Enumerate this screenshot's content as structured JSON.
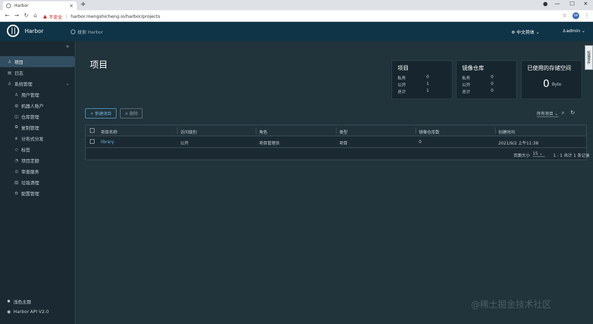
{
  "browser": {
    "tab_title": "Harbor",
    "new_tab": "+",
    "insecure_label": "不安全",
    "url": "harbor.mengshicheng.io/harbor/projects",
    "profile_initials": "SM"
  },
  "header": {
    "brand": "Harbor",
    "search_placeholder": "搜索 Harbor",
    "language": "中文简体",
    "user": "admin"
  },
  "sidebar": {
    "items": [
      {
        "label": "项目",
        "icon": "projects-icon"
      },
      {
        "label": "日志",
        "icon": "logs-icon"
      },
      {
        "label": "系统管理",
        "icon": "admin-icon"
      }
    ],
    "sub_items": [
      {
        "label": "用户管理",
        "icon": "users-icon"
      },
      {
        "label": "机器人账户",
        "icon": "robot-icon"
      },
      {
        "label": "仓库管理",
        "icon": "registry-icon"
      },
      {
        "label": "复制管理",
        "icon": "replication-icon"
      },
      {
        "label": "分布式分发",
        "icon": "distribution-icon"
      },
      {
        "label": "标签",
        "icon": "tag-icon"
      },
      {
        "label": "项目定额",
        "icon": "quota-icon"
      },
      {
        "label": "审查服务",
        "icon": "scanner-icon"
      },
      {
        "label": "垃圾清理",
        "icon": "gc-icon"
      },
      {
        "label": "配置管理",
        "icon": "config-icon"
      }
    ],
    "theme_label": "浅色主题",
    "api_label": "Harbor API V2.0"
  },
  "main": {
    "title": "项目",
    "cards": {
      "projects": {
        "title": "项目",
        "private_label": "私有",
        "private": "0",
        "public_label": "公开",
        "public": "1",
        "total_label": "总计",
        "total": "1"
      },
      "repos": {
        "title": "镜像仓库",
        "private_label": "私有",
        "private": "0",
        "public_label": "公开",
        "public": "0",
        "total_label": "总计",
        "total": "0"
      },
      "storage": {
        "title": "已使用的存储空间",
        "value": "0",
        "unit": "Byte"
      }
    },
    "new_project_label": "+ 新建项目",
    "delete_label": "✕ 删除",
    "filter_label": "所有项目",
    "table": {
      "headers": [
        "项目名称",
        "访问级别",
        "角色",
        "类型",
        "镜像仓库数",
        "创建时间"
      ],
      "rows": [
        [
          "library",
          "公开",
          "项目管理员",
          "项目",
          "0",
          "2021/9/2 上午11:38"
        ]
      ],
      "page_size_label": "页面大小",
      "page_size": "15",
      "summary": "1 - 1 共计 1 条记录"
    }
  },
  "event_tab": "拓展事件",
  "watermark": "@稀土掘金技术社区"
}
